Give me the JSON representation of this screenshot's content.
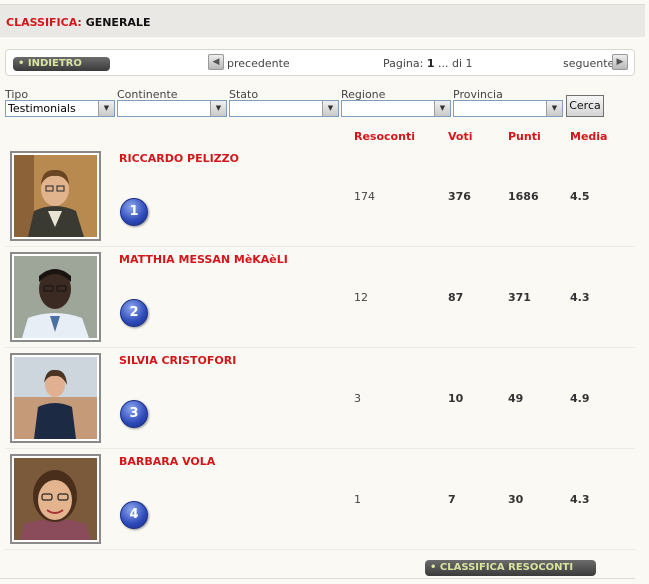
{
  "header": {
    "label": "CLASSIFICA:",
    "value": "GENERALE"
  },
  "nav": {
    "back_label": "INDIETRO",
    "prev_label": "precedente",
    "page_prefix": "Pagina:",
    "page_current": "1",
    "page_suffix": "... di 1",
    "next_label": "seguente"
  },
  "filters": {
    "tipo_label": "Tipo",
    "tipo_value": "Testimonials",
    "continente_label": "Continente",
    "continente_value": "",
    "stato_label": "Stato",
    "stato_value": "",
    "regione_label": "Regione",
    "regione_value": "",
    "provincia_label": "Provincia",
    "provincia_value": "",
    "search_label": "Cerca"
  },
  "columns": {
    "resoconti": "Resoconti",
    "voti": "Voti",
    "punti": "Punti",
    "media": "Media"
  },
  "rows": [
    {
      "rank": "1",
      "name": "RICCARDO PELIZZO",
      "resoconti": "174",
      "voti": "376",
      "punti": "1686",
      "media": "4.5"
    },
    {
      "rank": "2",
      "name": "MATTHIA MESSAN MèKAèLI",
      "resoconti": "12",
      "voti": "87",
      "punti": "371",
      "media": "4.3"
    },
    {
      "rank": "3",
      "name": "SILVIA CRISTOFORI",
      "resoconti": "3",
      "voti": "10",
      "punti": "49",
      "media": "4.9"
    },
    {
      "rank": "4",
      "name": "BARBARA VOLA",
      "resoconti": "1",
      "voti": "7",
      "punti": "30",
      "media": "4.3"
    }
  ],
  "footer": {
    "button_label": "CLASSIFICA RESOCONTI"
  }
}
